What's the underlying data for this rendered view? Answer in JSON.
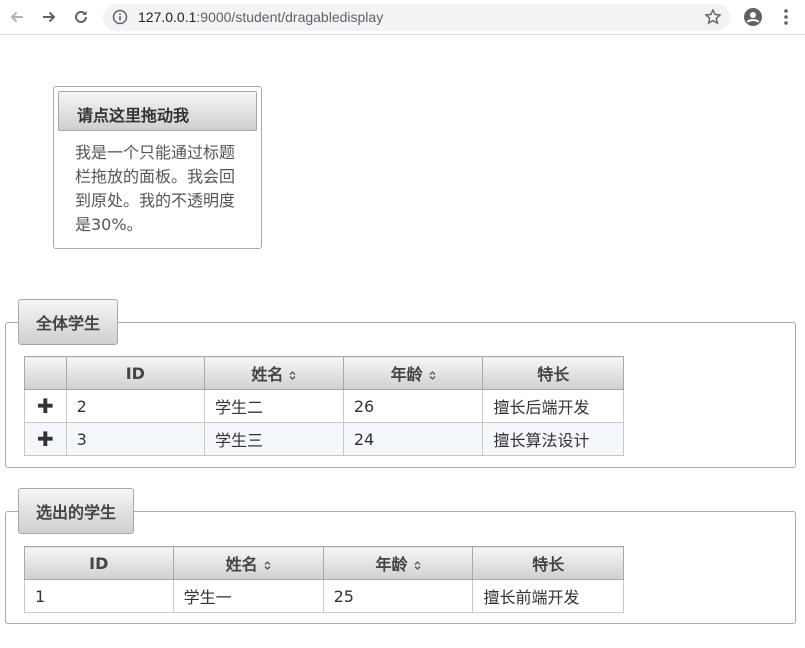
{
  "browser": {
    "url_host": "127.0.0.1",
    "url_rest": ":9000/student/dragabledisplay"
  },
  "drag_panel": {
    "title": "请点这里拖动我",
    "body": "我是一个只能通过标题栏拖放的面板。我会回到原处。我的不透明度是30%。"
  },
  "all_students": {
    "legend": "全体学生",
    "columns": [
      "",
      "ID",
      "姓名",
      "年龄",
      "特长"
    ],
    "rows": [
      {
        "expand": "✚",
        "id": "2",
        "name": "学生二",
        "age": "26",
        "skill": "擅长后端开发"
      },
      {
        "expand": "✚",
        "id": "3",
        "name": "学生三",
        "age": "24",
        "skill": "擅长算法设计"
      }
    ]
  },
  "selected_students": {
    "legend": "选出的学生",
    "columns": [
      "ID",
      "姓名",
      "年龄",
      "特长"
    ],
    "rows": [
      {
        "id": "1",
        "name": "学生一",
        "age": "25",
        "skill": "擅长前端开发"
      }
    ]
  }
}
